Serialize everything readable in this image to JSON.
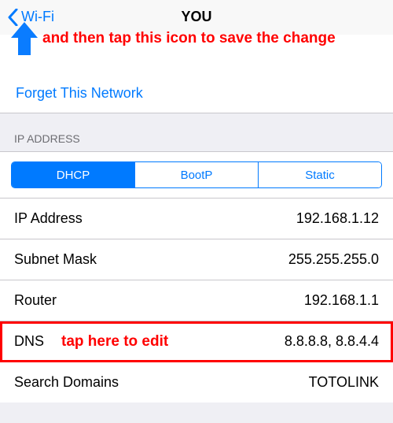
{
  "nav": {
    "back_label": "Wi-Fi",
    "title": "YOU"
  },
  "annotation": {
    "top_text": "and then tap this icon to save the change",
    "dns_text": "tap here to edit"
  },
  "section": {
    "forget_label": "Forget This Network",
    "ip_header": "IP ADDRESS"
  },
  "segments": {
    "dhcp": "DHCP",
    "bootp": "BootP",
    "static": "Static"
  },
  "rows": {
    "ip_label": "IP Address",
    "ip_value": "192.168.1.12",
    "subnet_label": "Subnet Mask",
    "subnet_value": "255.255.255.0",
    "router_label": "Router",
    "router_value": "192.168.1.1",
    "dns_label": "DNS",
    "dns_value": "8.8.8.8, 8.8.4.4",
    "search_label": "Search Domains",
    "search_value": "TOTOLINK"
  }
}
